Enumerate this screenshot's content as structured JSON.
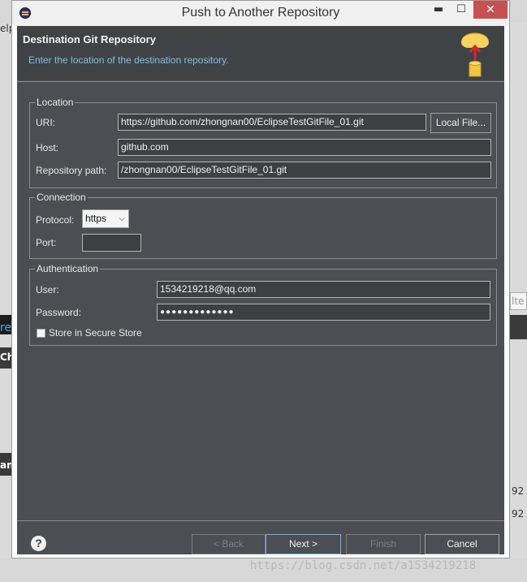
{
  "window": {
    "title": "Push to Another Repository",
    "minimize_glyph": "▬",
    "maximize_glyph": "☐",
    "close_glyph": "✕"
  },
  "background": {
    "left_fragments": [
      "elp",
      "re",
      "Ch",
      "an"
    ],
    "right_fragments": [
      "lte",
      "92",
      "92"
    ]
  },
  "banner": {
    "title": "Destination Git Repository",
    "description": "Enter the location of the destination repository.",
    "icon": "git-cloud-push-icon"
  },
  "location": {
    "legend": "Location",
    "uri_label": "URI:",
    "uri_value": "https://github.com/zhongnan00/EclipseTestGitFile_01.git",
    "local_file_button": "Local File...",
    "host_label": "Host:",
    "host_value": "github.com",
    "path_label": "Repository path:",
    "path_value": "/zhongnan00/EclipseTestGitFile_01.git"
  },
  "connection": {
    "legend": "Connection",
    "protocol_label": "Protocol:",
    "protocol_value": "https",
    "port_label": "Port:",
    "port_value": ""
  },
  "authentication": {
    "legend": "Authentication",
    "user_label": "User:",
    "user_value": "1534219218@qq.com",
    "password_label": "Password:",
    "password_value": "●●●●●●●●●●●●●",
    "store_label": "Store in Secure Store",
    "store_checked": false
  },
  "footer": {
    "help_glyph": "?",
    "back": "< Back",
    "next": "Next >",
    "finish": "Finish",
    "cancel": "Cancel"
  },
  "watermark": "https://blog.csdn.net/a1534219218"
}
